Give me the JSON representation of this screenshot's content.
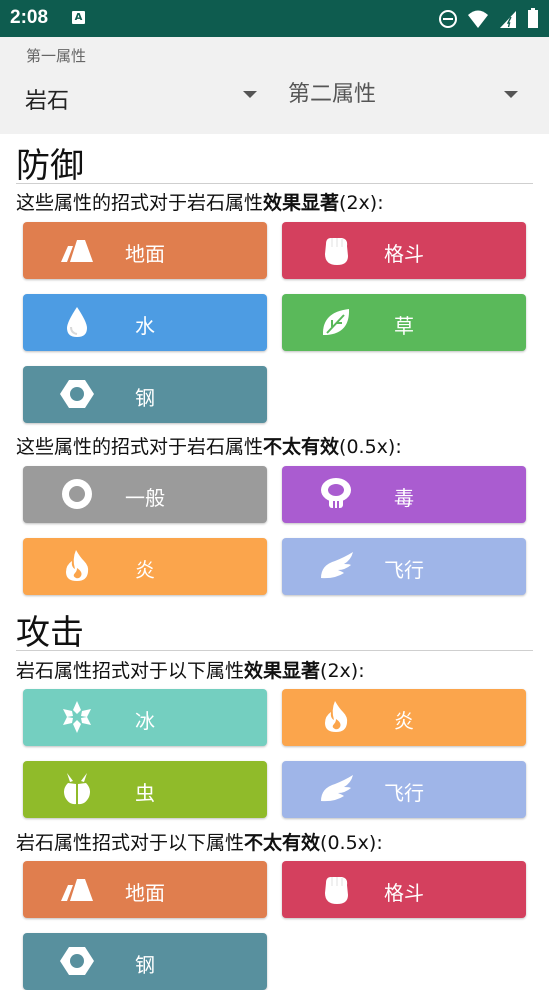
{
  "status_bar": {
    "time": "2:08",
    "notification_icon": "A"
  },
  "selector": {
    "label": "第一属性",
    "first_type": "岩石",
    "second_type_placeholder": "第二属性"
  },
  "defense": {
    "title": "防御",
    "weak_prefix": "这些属性的招式对于岩石属性",
    "weak_bold": "效果显著",
    "weak_suffix": "(2x):",
    "weak_types": [
      {
        "label": "地面",
        "icon": "ground-icon",
        "color": "#e07e4e"
      },
      {
        "label": "格斗",
        "icon": "fighting-icon",
        "color": "#d4405e"
      },
      {
        "label": "水",
        "icon": "water-icon",
        "color": "#4d9ce3"
      },
      {
        "label": "草",
        "icon": "grass-icon",
        "color": "#5ab95a"
      },
      {
        "label": "钢",
        "icon": "steel-icon",
        "color": "#58909e"
      }
    ],
    "resist_prefix": "这些属性的招式对于岩石属性",
    "resist_bold": "不太有效",
    "resist_suffix": "(0.5x):",
    "resist_types": [
      {
        "label": "一般",
        "icon": "normal-icon",
        "color": "#9b9b9b"
      },
      {
        "label": "毒",
        "icon": "poison-icon",
        "color": "#aa5cd0"
      },
      {
        "label": "炎",
        "icon": "fire-icon",
        "color": "#fba54c"
      },
      {
        "label": "飞行",
        "icon": "flying-icon",
        "color": "#9fb5e8"
      }
    ]
  },
  "attack": {
    "title": "攻击",
    "strong_prefix": "岩石属性招式对于以下属性",
    "strong_bold": "效果显著",
    "strong_suffix": "(2x):",
    "strong_types": [
      {
        "label": "冰",
        "icon": "ice-icon",
        "color": "#74cfc0"
      },
      {
        "label": "炎",
        "icon": "fire-icon",
        "color": "#fba54c"
      },
      {
        "label": "虫",
        "icon": "bug-icon",
        "color": "#90bb2a"
      },
      {
        "label": "飞行",
        "icon": "flying-icon",
        "color": "#9fb5e8"
      }
    ],
    "weak_prefix": "岩石属性招式对于以下属性",
    "weak_bold": "不太有效",
    "weak_suffix": "(0.5x):",
    "weak_types": [
      {
        "label": "地面",
        "icon": "ground-icon",
        "color": "#e07e4e"
      },
      {
        "label": "格斗",
        "icon": "fighting-icon",
        "color": "#d4405e"
      },
      {
        "label": "钢",
        "icon": "steel-icon",
        "color": "#58909e"
      }
    ]
  }
}
